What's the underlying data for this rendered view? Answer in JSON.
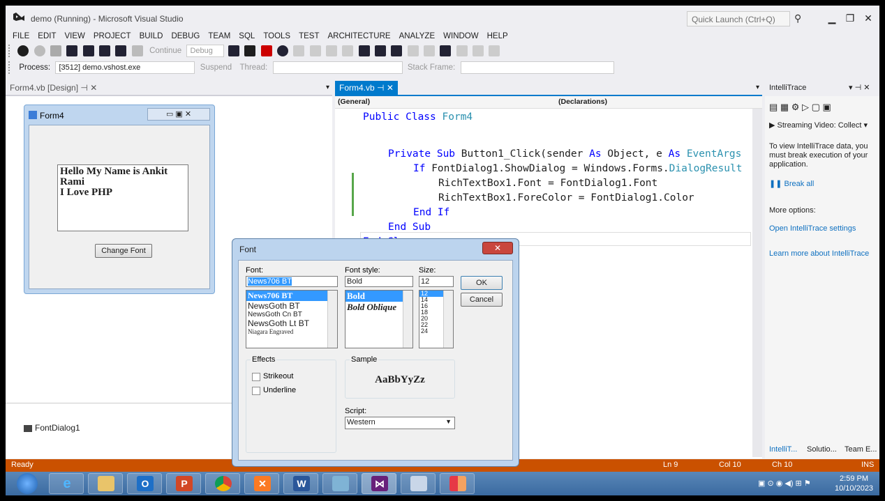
{
  "window": {
    "title": "demo (Running) - Microsoft Visual Studio",
    "quick_launch_placeholder": "Quick Launch (Ctrl+Q)"
  },
  "menu": [
    "FILE",
    "EDIT",
    "VIEW",
    "PROJECT",
    "BUILD",
    "DEBUG",
    "TEAM",
    "SQL",
    "TOOLS",
    "TEST",
    "ARCHITECTURE",
    "ANALYZE",
    "WINDOW",
    "HELP"
  ],
  "toolbar": {
    "continue_label": "Continue",
    "config_value": "Debug",
    "process_label": "Process:",
    "process_value": "[3512] demo.vshost.exe",
    "suspend_label": "Suspend",
    "thread_label": "Thread:",
    "stack_frame_label": "Stack Frame:"
  },
  "tabs": {
    "designer": "Form4.vb [Design]",
    "editor": "Form4.vb",
    "intellitrace": "IntelliTrace"
  },
  "designer": {
    "form_title": "Form4",
    "richtext_lines": "Hello My Name is Ankit\nRami\nI Love PHP",
    "button_label": "Change Font",
    "tray_component": "FontDialog1"
  },
  "editor": {
    "nav_left": "(General)",
    "nav_right": "(Declarations)",
    "code": [
      {
        "indent": 0,
        "parts": [
          [
            "kw",
            "Public Class "
          ],
          [
            "ty",
            "Form4"
          ]
        ]
      },
      {
        "indent": 0,
        "parts": [
          [
            "",
            ""
          ]
        ]
      },
      {
        "indent": 1,
        "parts": [
          [
            "kw",
            "Private Sub "
          ],
          [
            "",
            "Button1_Click(sender "
          ],
          [
            "kw",
            "As "
          ],
          [
            "",
            "Object, e "
          ],
          [
            "kw",
            "As "
          ],
          [
            "ty",
            "EventArgs"
          ]
        ]
      },
      {
        "indent": 2,
        "parts": [
          [
            "kw",
            "If "
          ],
          [
            "",
            "FontDialog1.ShowDialog = Windows.Forms."
          ],
          [
            "ty",
            "DialogResult"
          ]
        ]
      },
      {
        "indent": 3,
        "parts": [
          [
            "",
            "RichTextBox1.Font = FontDialog1.Font"
          ]
        ]
      },
      {
        "indent": 3,
        "parts": [
          [
            "",
            "RichTextBox1.ForeColor = FontDialog1.Color"
          ]
        ]
      },
      {
        "indent": 2,
        "parts": [
          [
            "kw",
            "End If"
          ]
        ]
      },
      {
        "indent": 1,
        "parts": [
          [
            "kw",
            "End Sub"
          ]
        ]
      },
      {
        "indent": 0,
        "parts": [
          [
            "kw",
            "End Class"
          ]
        ]
      }
    ]
  },
  "intellitrace": {
    "video": "Streaming Video: Collect",
    "message": "To view IntelliTrace data, you must break execution of your application.",
    "break_all": "Break all",
    "more_options": "More options:",
    "open_settings": "Open IntelliTrace settings",
    "learn_more": "Learn more about IntelliTrace",
    "bottom_tabs": [
      "IntelliT...",
      "Solutio...",
      "Team E..."
    ]
  },
  "status": {
    "ready": "Ready",
    "ln": "Ln 9",
    "col": "Col 10",
    "ch": "Ch 10",
    "ins": "INS"
  },
  "taskbar": {
    "time": "2:59 PM",
    "date": "10/10/2023"
  },
  "font_dialog": {
    "title": "Font",
    "font_label": "Font:",
    "font_value": "News706 BT",
    "font_list": [
      "News706 BT",
      "NewsGoth BT",
      "NewsGoth Cn BT",
      "NewsGoth Lt BT",
      "Niagara Engraved"
    ],
    "style_label": "Font style:",
    "style_value": "Bold",
    "style_list": [
      "Bold",
      "Bold Oblique"
    ],
    "size_label": "Size:",
    "size_value": "12",
    "size_list": [
      "12",
      "14",
      "16",
      "18",
      "20",
      "22",
      "24"
    ],
    "ok": "OK",
    "cancel": "Cancel",
    "effects_label": "Effects",
    "strikeout": "Strikeout",
    "underline": "Underline",
    "sample_label": "Sample",
    "sample_text": "AaBbYyZz",
    "script_label": "Script:",
    "script_value": "Western"
  }
}
